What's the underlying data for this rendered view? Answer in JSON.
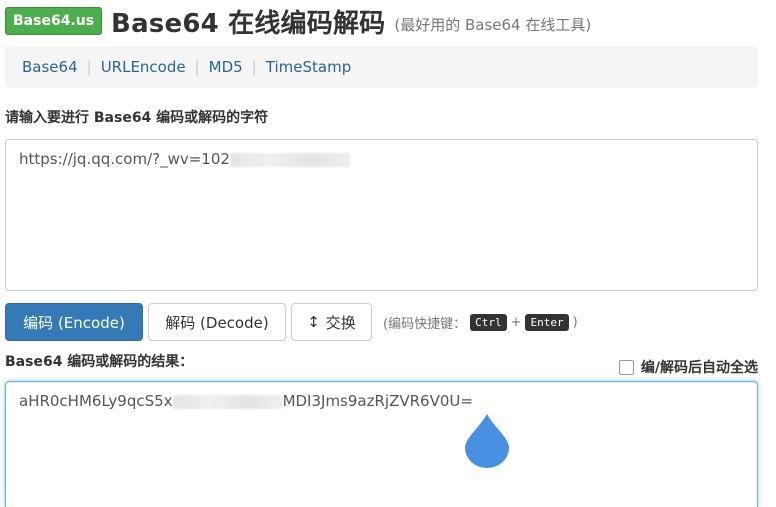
{
  "header": {
    "logo_text": "Base64.us",
    "title": "Base64 在线编码解码",
    "subtitle": "(最好用的 Base64 在线工具)"
  },
  "nav": {
    "items": [
      "Base64",
      "URLEncode",
      "MD5",
      "TimeStamp"
    ],
    "separator": "|"
  },
  "input": {
    "label": "请输入要进行 Base64 编码或解码的字符",
    "value_visible": "https://jq.qq.com/?_wv=102"
  },
  "buttons": {
    "encode": "编码 (Encode)",
    "decode": "解码 (Decode)",
    "swap": "交换",
    "swap_icon": "↕"
  },
  "hint": {
    "prefix": "(编码快捷键：",
    "key1": "Ctrl",
    "plus": "+",
    "key2": "Enter",
    "suffix": ")"
  },
  "output": {
    "label": "Base64 编码或解码的结果：",
    "auto_select_label": "编/解码后自动全选",
    "value_start": "aHR0cHM6Ly9qcS5x",
    "value_end": "MDI3Jms9azRjZVR6V0U="
  },
  "colors": {
    "brand_green": "#4cae4c",
    "primary_blue": "#337ab7",
    "focus_blue": "#66afe9",
    "drop_blue": "#4a90e2"
  }
}
